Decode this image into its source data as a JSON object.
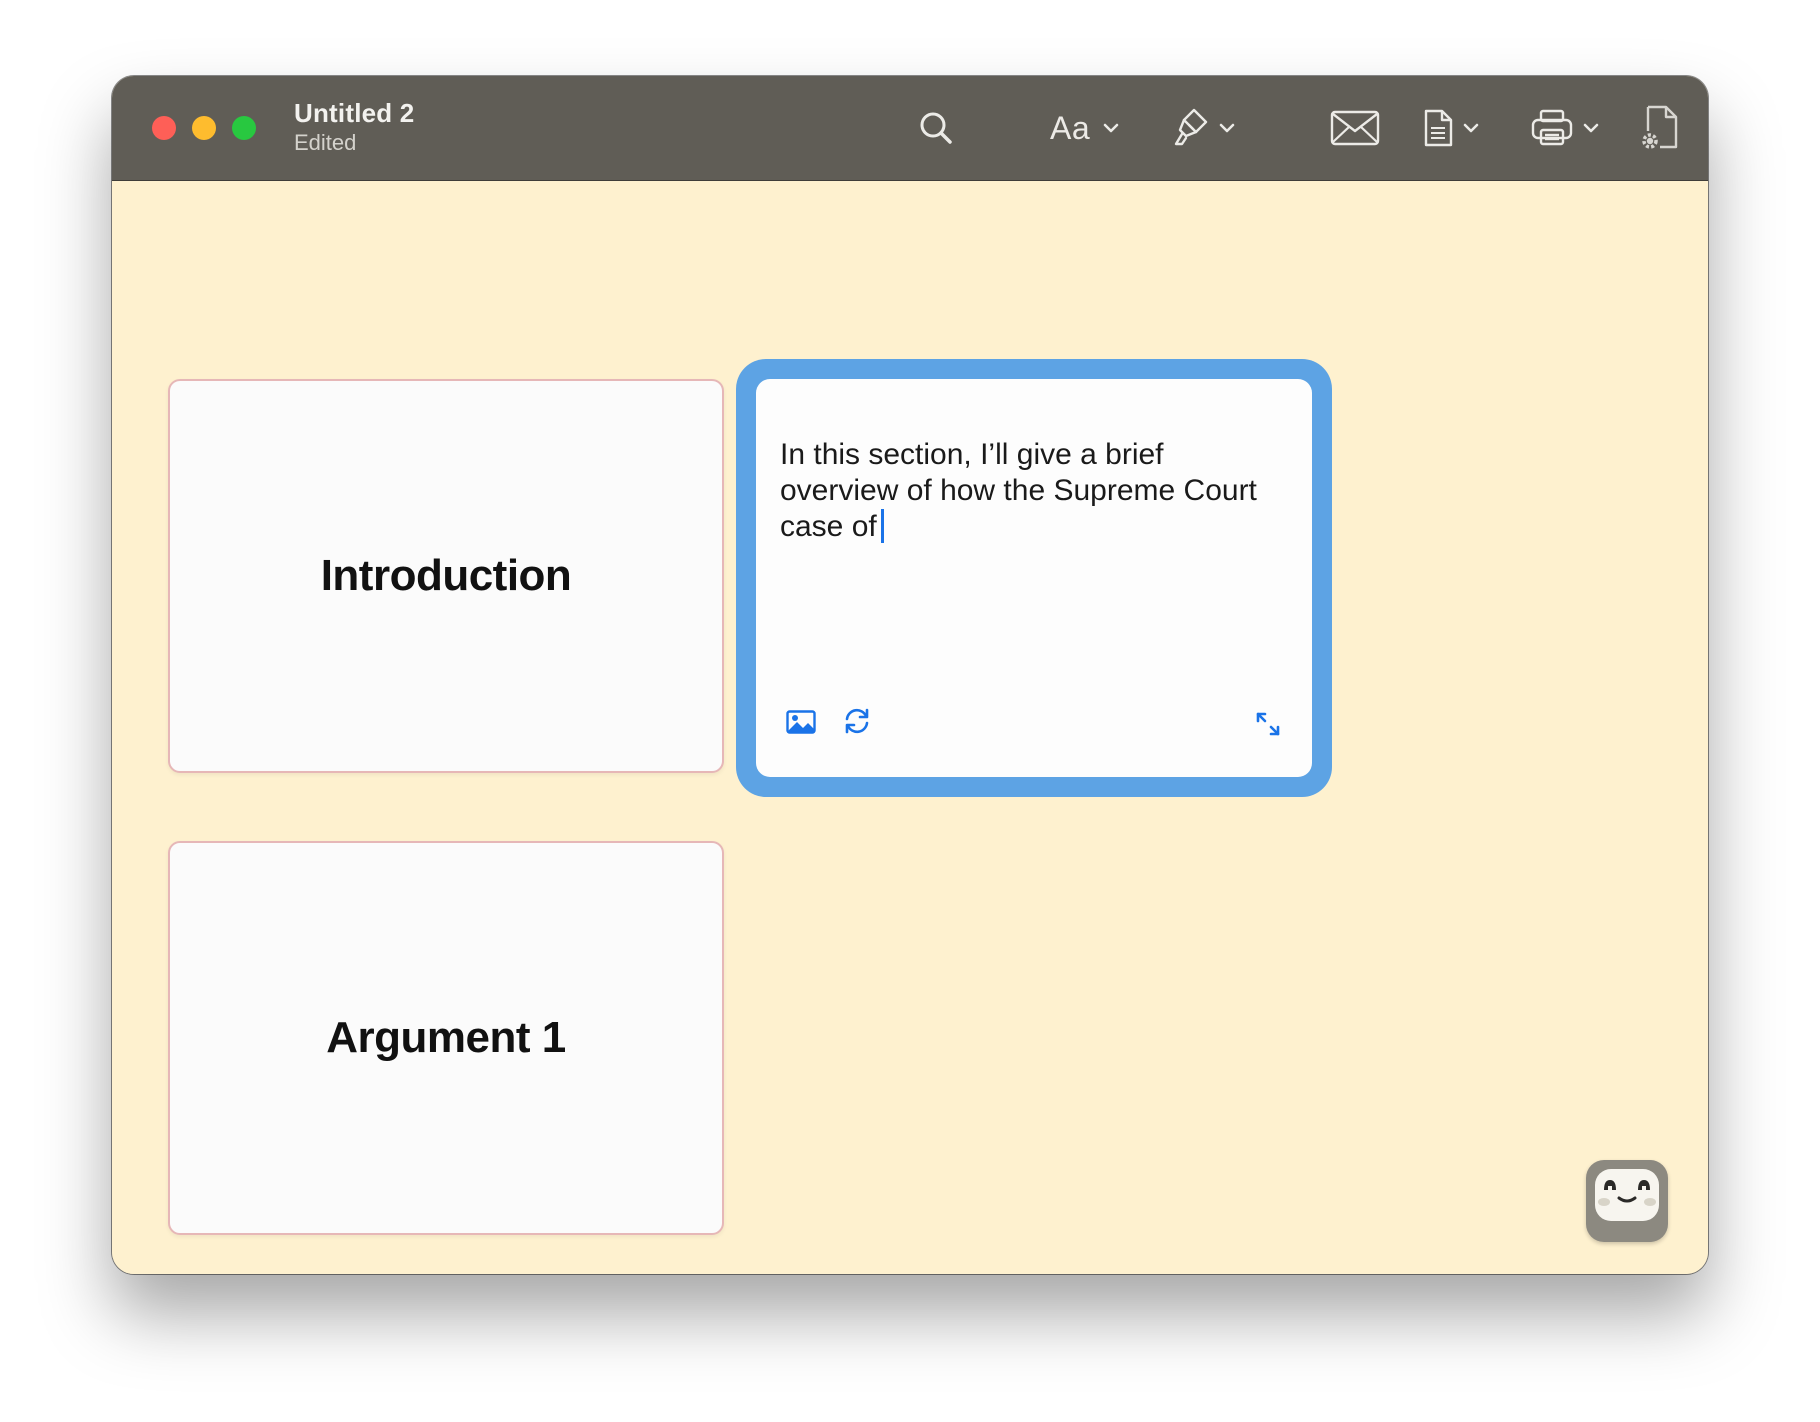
{
  "window": {
    "title": "Untitled 2",
    "status": "Edited"
  },
  "toolbar": {
    "search_icon": "search-icon",
    "font_label": "Aa",
    "items": [
      "search",
      "font-menu",
      "highlighter-menu",
      "mail",
      "document-menu",
      "print-menu",
      "document-settings"
    ]
  },
  "cards": [
    {
      "title": "Introduction"
    },
    {
      "title": "Argument 1"
    },
    {
      "title": ""
    }
  ],
  "active_card": {
    "text": "In this section, I’ll give a brief overview of how the Supreme Court case of",
    "icons": [
      "image-icon",
      "refresh-icon",
      "expand-icon"
    ]
  },
  "colors": {
    "titlebar": "#605d56",
    "canvas": "#fef1cf",
    "card_border": "#e6b7b7",
    "focus_ring": "#5da3e4",
    "accent": "#1a73e8"
  }
}
